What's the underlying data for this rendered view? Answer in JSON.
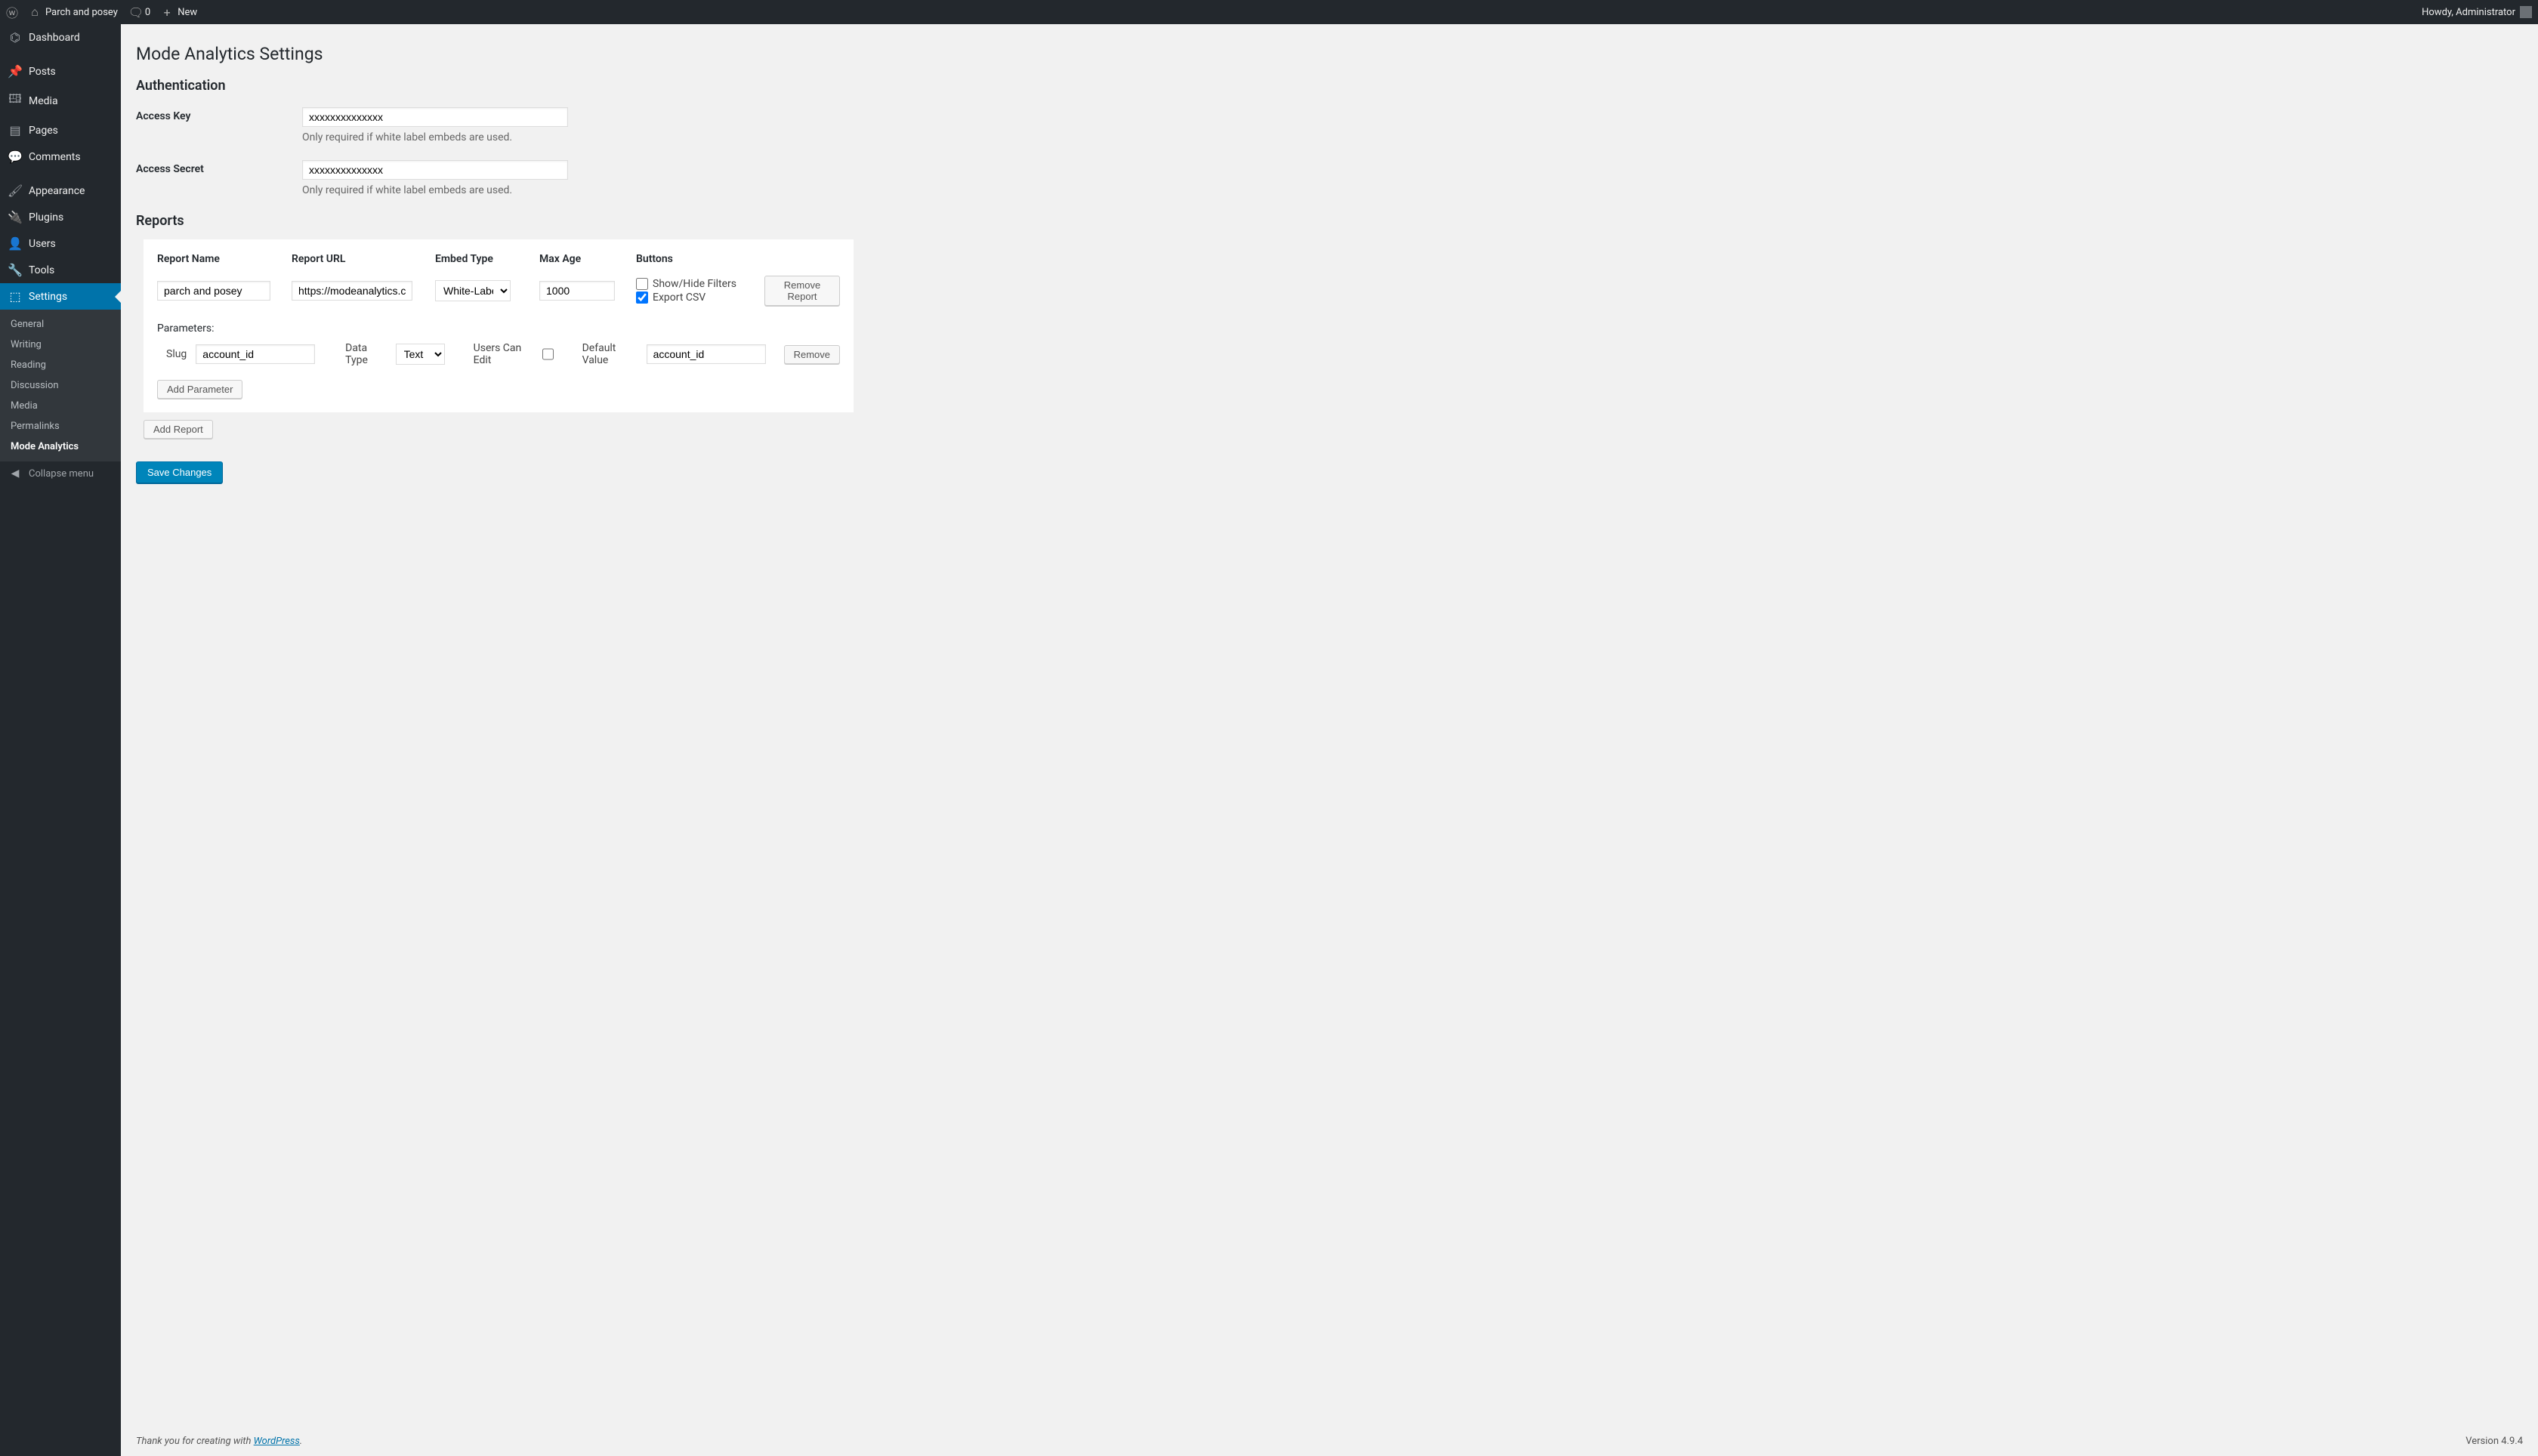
{
  "adminbar": {
    "site_name": "Parch and posey",
    "comments_count": "0",
    "new_label": "New",
    "howdy": "Howdy, Administrator"
  },
  "sidebar": {
    "items": [
      {
        "label": "Dashboard",
        "icon": "⌬"
      },
      {
        "label": "Posts",
        "icon": "📌"
      },
      {
        "label": "Media",
        "icon": "🖽"
      },
      {
        "label": "Pages",
        "icon": "▤"
      },
      {
        "label": "Comments",
        "icon": "💬"
      },
      {
        "label": "Appearance",
        "icon": "🖌"
      },
      {
        "label": "Plugins",
        "icon": "🔌"
      },
      {
        "label": "Users",
        "icon": "👤"
      },
      {
        "label": "Tools",
        "icon": "🔧"
      },
      {
        "label": "Settings",
        "icon": "⬚"
      }
    ],
    "submenu": [
      "General",
      "Writing",
      "Reading",
      "Discussion",
      "Media",
      "Permalinks",
      "Mode Analytics"
    ],
    "collapse": "Collapse menu"
  },
  "page": {
    "title": "Mode Analytics Settings",
    "auth_heading": "Authentication",
    "access_key_label": "Access Key",
    "access_key_value": "xxxxxxxxxxxxxx",
    "access_key_desc": "Only required if white label embeds are used.",
    "access_secret_label": "Access Secret",
    "access_secret_value": "xxxxxxxxxxxxxx",
    "access_secret_desc": "Only required if white label embeds are used.",
    "reports_heading": "Reports",
    "columns": {
      "name": "Report Name",
      "url": "Report URL",
      "embed": "Embed Type",
      "age": "Max Age",
      "buttons": "Buttons"
    },
    "report": {
      "name": "parch and posey",
      "url": "https://modeanalytics.c",
      "embed": "White-Label",
      "age": "1000",
      "show_hide_label": "Show/Hide Filters",
      "export_csv_label": "Export CSV",
      "remove_label": "Remove Report"
    },
    "params_label": "Parameters:",
    "param": {
      "slug_label": "Slug",
      "slug_value": "account_id",
      "data_type_label": "Data Type",
      "data_type_value": "Text",
      "users_edit_label": "Users Can Edit",
      "default_label": "Default Value",
      "default_value": "account_id",
      "remove_label": "Remove"
    },
    "add_parameter": "Add Parameter",
    "add_report": "Add Report",
    "save_changes": "Save Changes"
  },
  "footer": {
    "thanks_prefix": "Thank you for creating with ",
    "wp_link": "WordPress",
    "thanks_suffix": ".",
    "version": "Version 4.9.4"
  }
}
